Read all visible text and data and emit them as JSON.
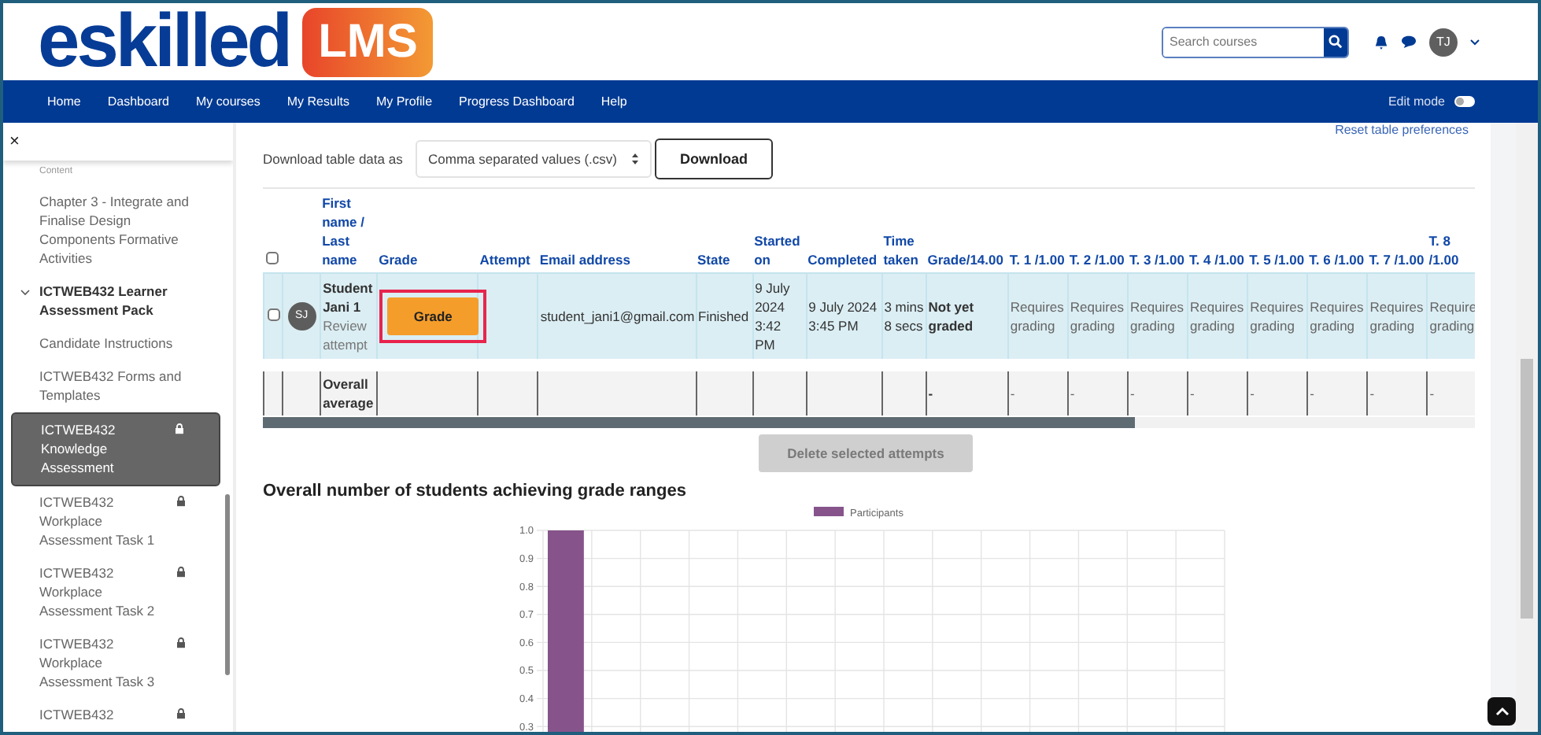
{
  "header": {
    "logo": {
      "text": "eskilled",
      "badge": "LMS"
    },
    "search": {
      "placeholder": "Search courses"
    },
    "user": {
      "initials": "TJ"
    }
  },
  "nav": {
    "items": [
      "Home",
      "Dashboard",
      "My courses",
      "My Results",
      "My Profile",
      "Progress Dashboard",
      "Help"
    ],
    "edit_mode": {
      "label": "Edit mode",
      "on": false
    }
  },
  "sidebar": {
    "close": "×",
    "items": [
      {
        "kind": "activity",
        "label": "Content",
        "locked": false,
        "selected": false
      },
      {
        "kind": "activity",
        "label": "Chapter 3 - Integrate and Finalise Design Components Formative Activities",
        "locked": false,
        "selected": false
      },
      {
        "kind": "section",
        "label": "ICTWEB432 Learner Assessment Pack",
        "expanded": true,
        "children": [
          {
            "kind": "activity",
            "label": "Candidate Instructions",
            "locked": false,
            "selected": false
          },
          {
            "kind": "activity",
            "label": "ICTWEB432 Forms and Templates",
            "locked": false,
            "selected": false
          },
          {
            "kind": "activity",
            "label": "ICTWEB432 Knowledge Assessment",
            "locked": true,
            "selected": true
          },
          {
            "kind": "activity",
            "label": "ICTWEB432 Workplace Assessment Task 1",
            "locked": true,
            "selected": false
          },
          {
            "kind": "activity",
            "label": "ICTWEB432 Workplace Assessment Task 2",
            "locked": true,
            "selected": false
          },
          {
            "kind": "activity",
            "label": "ICTWEB432 Workplace Assessment Task 3",
            "locked": true,
            "selected": false
          },
          {
            "kind": "activity",
            "label": "ICTWEB432",
            "locked": true,
            "selected": false
          }
        ]
      }
    ]
  },
  "content": {
    "reset_link": "Reset table preferences",
    "download": {
      "label": "Download table data as",
      "format": "Comma separated values (.csv)",
      "button": "Download"
    },
    "table": {
      "select_all_checked": false,
      "columns": [
        "First name / Last name",
        "Grade",
        "Attempt",
        "Email address",
        "State",
        "Started on",
        "Completed",
        "Time taken",
        "Grade/14.00",
        "T. 1 /1.00",
        "T. 2 /1.00",
        "T. 3 /1.00",
        "T. 4 /1.00",
        "T. 5 /1.00",
        "T. 6 /1.00",
        "T. 7 /1.00",
        "T. 8 /1.00"
      ],
      "rows": [
        {
          "checked": false,
          "initials": "SJ",
          "name": "Student Jani 1",
          "review": "Review attempt",
          "grade_button": "Grade",
          "email": "student_jani1@gmail.com",
          "state": "Finished",
          "started": "9 July 2024 3:42 PM",
          "completed": "9 July 2024 3:45 PM",
          "time_taken": "3 mins 8 secs",
          "grade": "Not yet graded",
          "marks": [
            "Requires grading",
            "Requires grading",
            "Requires grading",
            "Requires grading",
            "Requires grading",
            "Requires grading",
            "Requires grading",
            "Require grading"
          ]
        }
      ],
      "average": {
        "label": "Overall average",
        "grade": "-",
        "marks": [
          "-",
          "-",
          "-",
          "-",
          "-",
          "-",
          "-",
          "-"
        ]
      }
    },
    "delete_button": {
      "label": "Delete selected attempts",
      "disabled": true
    },
    "chart": {
      "title": "Overall number of students achieving grade ranges",
      "chart_data": {
        "type": "bar",
        "grid": true,
        "ylim": [
          0.3,
          1.0
        ],
        "yticks": [
          {
            "value": 0.3,
            "label": "0.3"
          },
          {
            "value": 0.4,
            "label": "0.4"
          },
          {
            "value": 0.5,
            "label": "0.5"
          },
          {
            "value": 0.6,
            "label": "0.6"
          },
          {
            "value": 0.7,
            "label": "0.7"
          },
          {
            "value": 0.8,
            "label": "0.8"
          },
          {
            "value": 0.9,
            "label": "0.9"
          },
          {
            "value": 1.0,
            "label": "1.0"
          }
        ],
        "series": [
          {
            "name": "Participants",
            "color": "#86548b",
            "values": [
              1,
              null,
              null,
              null,
              null,
              null,
              null,
              null,
              null,
              null,
              null,
              null,
              null,
              null
            ]
          }
        ]
      }
    }
  }
}
